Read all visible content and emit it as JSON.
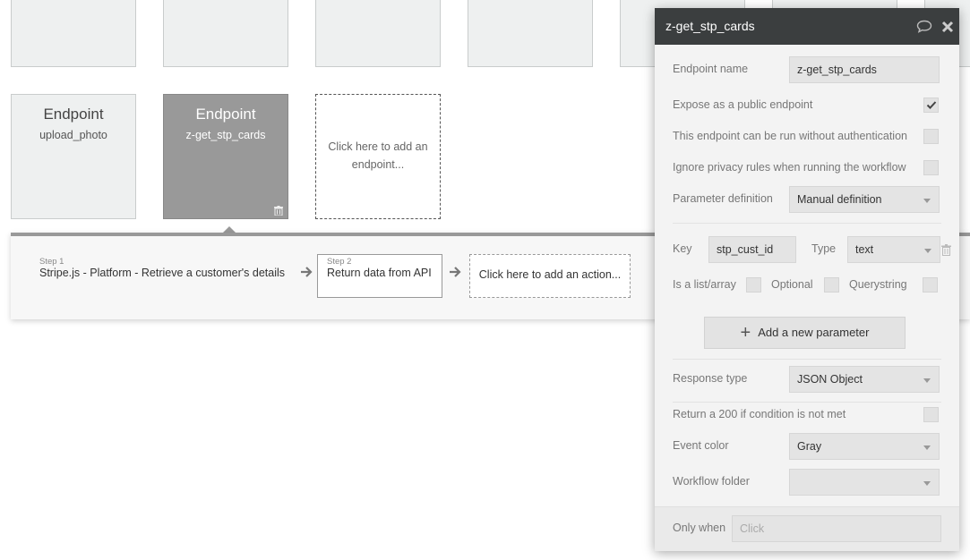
{
  "endpoints": {
    "cards": [
      {
        "title": "Endpoint",
        "subtitle": "upload_photo",
        "selected": false
      },
      {
        "title": "Endpoint",
        "subtitle": "z-get_stp_cards",
        "selected": true
      }
    ],
    "add_card_text": "Click here to add an endpoint..."
  },
  "workflow": {
    "steps": [
      {
        "label": "Step 1",
        "name": "Stripe.js - Platform - Retrieve a customer's details"
      },
      {
        "label": "Step 2",
        "name": "Return data from API"
      }
    ],
    "add_action_text": "Click here to add an action..."
  },
  "panel": {
    "title": "z-get_stp_cards",
    "endpoint_name_label": "Endpoint name",
    "endpoint_name_value": "z-get_stp_cards",
    "expose_label": "Expose as a public endpoint",
    "expose_checked": true,
    "no_auth_label": "This endpoint can be run without authentication",
    "no_auth_checked": false,
    "ignore_privacy_label": "Ignore privacy rules when running the workflow",
    "ignore_privacy_checked": false,
    "param_def_label": "Parameter definition",
    "param_def_value": "Manual definition",
    "param": {
      "key_label": "Key",
      "key_value": "stp_cust_id",
      "type_label": "Type",
      "type_value": "text",
      "is_list_label": "Is a list/array",
      "optional_label": "Optional",
      "querystring_label": "Querystring"
    },
    "add_param_label": "Add a new parameter",
    "response_type_label": "Response type",
    "response_type_value": "JSON Object",
    "return200_label": "Return a 200 if condition is not met",
    "event_color_label": "Event color",
    "event_color_value": "Gray",
    "folder_label": "Workflow folder",
    "folder_value": "",
    "only_when_label": "Only when",
    "only_when_placeholder": "Click"
  },
  "colors": {
    "panel_header": "#3b3e3f",
    "selected_card": "#999999",
    "panel_bg": "#f3f3f3"
  },
  "icons": [
    "comment-icon",
    "close-icon",
    "trash-icon",
    "checkmark-icon",
    "arrow-right-icon",
    "plus-icon",
    "dropdown-caret-icon"
  ]
}
